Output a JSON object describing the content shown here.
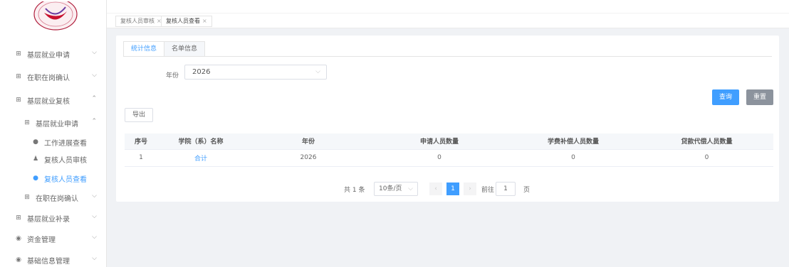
{
  "colors": {
    "accent": "#409eff",
    "reset": "#8c939d"
  },
  "sidebar": {
    "items": [
      {
        "icon": "book-icon",
        "label": "基层就业申请",
        "level": 1
      },
      {
        "icon": "book-icon",
        "label": "在职在岗确认",
        "level": 1
      },
      {
        "icon": "book-icon",
        "label": "基层就业复核",
        "level": 1
      },
      {
        "icon": "book-icon",
        "label": "基层就业申请",
        "level": 2
      },
      {
        "icon": "eye-icon",
        "label": "工作进展查看",
        "level": 3
      },
      {
        "icon": "person-icon",
        "label": "复核人员审核",
        "level": 3
      },
      {
        "icon": "eye-icon",
        "label": "复核人员查看",
        "level": 3,
        "active": true
      },
      {
        "icon": "book-icon",
        "label": "在职在岗确认",
        "level": 2
      },
      {
        "icon": "book-icon",
        "label": "基层就业补录",
        "level": 1
      },
      {
        "icon": "money-icon",
        "label": "资金管理",
        "level": 1
      },
      {
        "icon": "money-icon",
        "label": "基础信息管理",
        "level": 1
      }
    ]
  },
  "tagsbar": {
    "tags": [
      {
        "label": "复核人员审核"
      },
      {
        "label": "复核人员查看",
        "active": true
      }
    ],
    "close": "×"
  },
  "tabs": [
    {
      "label": "统计信息",
      "active": true
    },
    {
      "label": "名单信息"
    }
  ],
  "filter": {
    "year_label": "年份",
    "year_value": "2026"
  },
  "buttons": {
    "search": "查询",
    "reset": "重置",
    "export": "导出"
  },
  "table": {
    "headers": [
      "序号",
      "学院（系）名称",
      "年份",
      "申请人员数量",
      "学费补偿人员数量",
      "贷款代偿人员数量"
    ],
    "rows": [
      [
        "1",
        "合计",
        "2026",
        "0",
        "0",
        "0"
      ]
    ]
  },
  "pagination": {
    "total": "共 1 条",
    "page_size": "10条/页",
    "current_page": "1",
    "goto_label": "前往",
    "goto_value": "1",
    "page_word": "页"
  }
}
